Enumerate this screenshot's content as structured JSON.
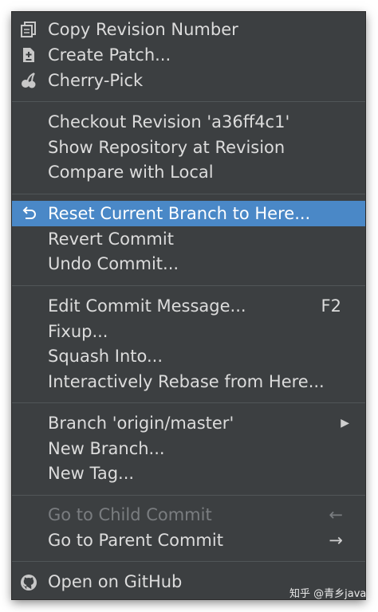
{
  "menu": {
    "copy_revision": {
      "label": "Copy Revision Number",
      "icon": "copy-icon"
    },
    "create_patch": {
      "label": "Create Patch...",
      "icon": "patch-icon"
    },
    "cherry_pick": {
      "label": "Cherry-Pick",
      "icon": "cherry-icon"
    },
    "checkout_revision": {
      "label": "Checkout Revision 'a36ff4c1'"
    },
    "show_repository": {
      "label": "Show Repository at Revision"
    },
    "compare_local": {
      "label": "Compare with Local"
    },
    "reset_branch": {
      "label": "Reset Current Branch to Here...",
      "icon": "undo-arrow-icon",
      "selected": true
    },
    "revert_commit": {
      "label": "Revert Commit"
    },
    "undo_commit": {
      "label": "Undo Commit..."
    },
    "edit_message": {
      "label": "Edit Commit Message...",
      "shortcut": "F2"
    },
    "fixup": {
      "label": "Fixup..."
    },
    "squash": {
      "label": "Squash Into..."
    },
    "interactive_rebase": {
      "label": "Interactively Rebase from Here..."
    },
    "branch_origin": {
      "label": "Branch 'origin/master'",
      "submenu_arrow": "▶"
    },
    "new_branch": {
      "label": "New Branch..."
    },
    "new_tag": {
      "label": "New Tag..."
    },
    "go_child": {
      "label": "Go to Child Commit",
      "arrow": "←",
      "disabled": true
    },
    "go_parent": {
      "label": "Go to Parent Commit",
      "arrow": "→"
    },
    "open_github": {
      "label": "Open on GitHub",
      "icon": "github-icon"
    }
  },
  "watermark": "知乎 @青乡java",
  "colors": {
    "menu_background": "#3c3f41",
    "selection": "#4a88c7",
    "text": "#dcdcdc",
    "disabled_text": "#7a7d80"
  }
}
